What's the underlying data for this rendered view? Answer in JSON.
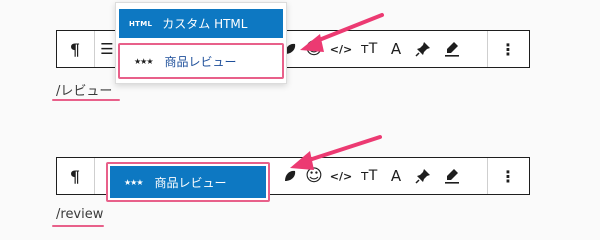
{
  "colors": {
    "accent": "#0d78c2",
    "highlight": "#e8608a"
  },
  "toolbar_top": {
    "paragraph_icon": "¶",
    "more_label": "⋮",
    "icons": [
      "leaf-icon",
      "emoji-icon",
      "code-icon",
      "text-size-icon",
      "font-icon",
      "pin-icon",
      "highlighter-icon"
    ]
  },
  "inserter_top": {
    "items": [
      {
        "icon": "HTML",
        "label": "カスタム HTML"
      },
      {
        "icon": "★★★",
        "label": "商品レビュー"
      }
    ]
  },
  "inserter_bottom": {
    "items": [
      {
        "icon": "★★★",
        "label": "商品レビュー"
      }
    ]
  },
  "slash_commands": {
    "top": "/レビュー",
    "bottom": "/review"
  },
  "toolbar_glyphs": {
    "emoji": "☺",
    "code": "</>",
    "text_size": "тT",
    "font": "A",
    "pin": "✎",
    "highlight": "✐"
  }
}
